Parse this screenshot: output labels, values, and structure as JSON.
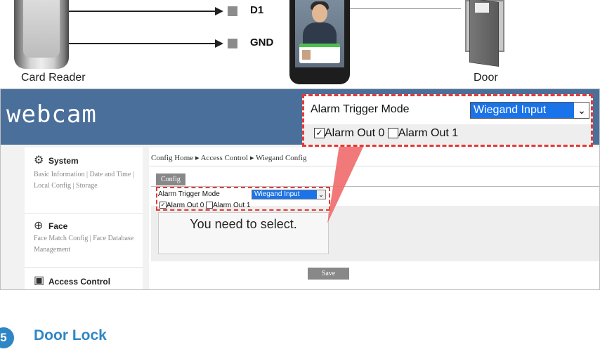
{
  "diagram": {
    "pins": [
      "D1",
      "GND"
    ],
    "card_reader_caption": "Card Reader",
    "door_caption": "Door"
  },
  "webcam": {
    "brand": "webcam",
    "sidebar": [
      {
        "title": "System",
        "icon": "gear-icon",
        "links": "Basic Information | Date and Time | Local Config | Storage"
      },
      {
        "title": "Face",
        "icon": "face-scan-icon",
        "links": "Face Match Config | Face Database Management"
      },
      {
        "title": "Access Control",
        "icon": "access-control-icon",
        "links": ""
      }
    ],
    "breadcrumb": "Config Home ▸ Access Control ▸ Wiegand Config",
    "tab": "Config",
    "alarm_trigger_label": "Alarm Trigger Mode",
    "alarm_trigger_value": "Wiegand Input",
    "alarm_out_0": "Alarm Out 0",
    "alarm_out_1": "Alarm Out 1",
    "note": "You need to select.",
    "save_label": "Save"
  },
  "callout": {
    "label": "Alarm Trigger Mode",
    "value": "Wiegand Input",
    "alarm_out_0": "Alarm Out 0",
    "alarm_out_1": "Alarm Out 1"
  },
  "section": {
    "number": "5",
    "title": "Door Lock"
  },
  "colors": {
    "header_blue": "#4a6f9a",
    "highlight_red": "#e53935",
    "heading_blue": "#2f86c6",
    "select_blue": "#1a73e8"
  }
}
